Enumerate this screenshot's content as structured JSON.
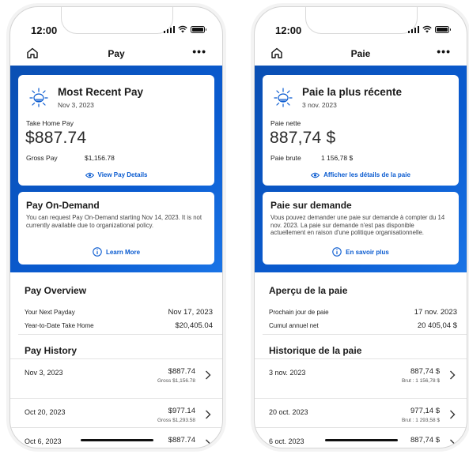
{
  "screens": [
    {
      "status_time": "12:00",
      "nav_title": "Pay",
      "more": "•••",
      "recent": {
        "title": "Most Recent Pay",
        "date": "Nov 3, 2023",
        "take_home_label": "Take Home Pay",
        "take_home_amount": "$887.74",
        "gross_label": "Gross Pay",
        "gross_amount": "$1,156.78",
        "view_link": "View Pay Details"
      },
      "demand": {
        "title": "Pay On-Demand",
        "text": "You can request Pay On-Demand starting Nov 14, 2023. It is not currently available due to organizational policy.",
        "learn_link": "Learn More"
      },
      "overview": {
        "title": "Pay Overview",
        "rows": [
          {
            "label": "Your Next Payday",
            "value": "Nov 17, 2023"
          },
          {
            "label": "Year-to-Date Take Home",
            "value": "$20,405.04"
          }
        ]
      },
      "history": {
        "title": "Pay History",
        "rows": [
          {
            "date": "Nov 3, 2023",
            "amount": "$887.74",
            "gross": "Gross $1,156.78"
          },
          {
            "date": "Oct 20, 2023",
            "amount": "$977.14",
            "gross": "Gross $1,293.58"
          },
          {
            "date": "Oct 6, 2023",
            "amount": "$887.74",
            "gross": ""
          }
        ]
      }
    },
    {
      "status_time": "12:00",
      "nav_title": "Paie",
      "more": "•••",
      "recent": {
        "title": "Paie la plus récente",
        "date": "3 nov. 2023",
        "take_home_label": "Paie nette",
        "take_home_amount": "887,74 $",
        "gross_label": "Paie brute",
        "gross_amount": "1 156,78 $",
        "view_link": "Afficher les détails de la paie"
      },
      "demand": {
        "title": "Paie sur demande",
        "text": "Vous pouvez demander une paie sur demande à compter du 14 nov. 2023. La paie sur demande n'est pas disponible actuellement en raison d'une politique organisationnelle.",
        "learn_link": "En savoir plus"
      },
      "overview": {
        "title": "Aperçu de la paie",
        "rows": [
          {
            "label": "Prochain jour de paie",
            "value": "17 nov. 2023"
          },
          {
            "label": "Cumul annuel net",
            "value": "20 405,04 $"
          }
        ]
      },
      "history": {
        "title": "Historique de la paie",
        "rows": [
          {
            "date": "3 nov. 2023",
            "amount": "887,74 $",
            "gross": "Brut : 1 156,78 $"
          },
          {
            "date": "20 oct. 2023",
            "amount": "977,14 $",
            "gross": "Brut : 1 293,58 $"
          },
          {
            "date": "6 oct. 2023",
            "amount": "887,74 $",
            "gross": ""
          }
        ]
      }
    }
  ],
  "colors": {
    "brand_blue": "#0a5bd0",
    "link_blue": "#0a5bd0"
  },
  "icons": {
    "home": "home-icon",
    "more": "more-icon",
    "sun": "sun-icon",
    "eye": "eye-icon",
    "info": "info-icon",
    "chevron": "chevron-right-icon"
  }
}
